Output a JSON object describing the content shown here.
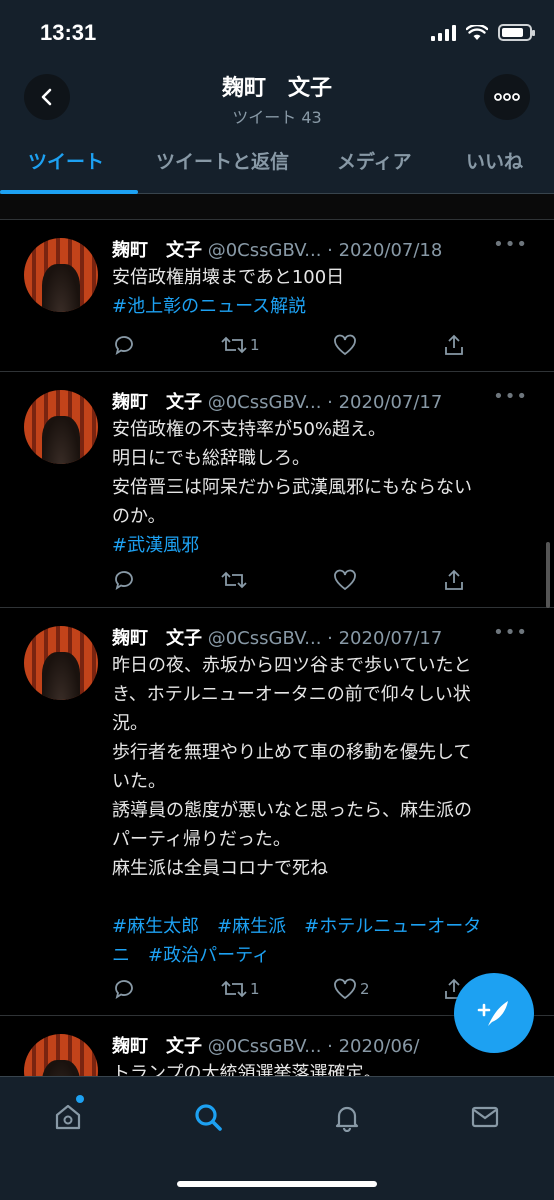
{
  "status_bar": {
    "time": "13:31"
  },
  "header": {
    "title": "麹町　文子",
    "subtitle": "ツイート 43"
  },
  "tabs": [
    {
      "label": "ツイート"
    },
    {
      "label": "ツイートと返信"
    },
    {
      "label": "メディア"
    },
    {
      "label": "いいね"
    }
  ],
  "tweets": [
    {
      "name": "麹町　文子",
      "handle": "@0CssGBV...",
      "sep": " · ",
      "date": "2020/07/18",
      "lines": [
        "安倍政権崩壊まであと100日"
      ],
      "hashtags": [
        "#池上彰のニュース解説"
      ],
      "retweets": "1",
      "likes": ""
    },
    {
      "name": "麹町　文子",
      "handle": "@0CssGBV...",
      "sep": " · ",
      "date": "2020/07/17",
      "lines": [
        "安倍政権の不支持率が50%超え。",
        "明日にでも総辞職しろ。",
        "安倍晋三は阿呆だから武漢風邪にもならない",
        "のか。"
      ],
      "hashtags": [
        "#武漢風邪"
      ],
      "retweets": "",
      "likes": ""
    },
    {
      "name": "麹町　文子",
      "handle": "@0CssGBV...",
      "sep": " · ",
      "date": "2020/07/17",
      "lines": [
        "昨日の夜、赤坂から四ツ谷まで歩いていたと",
        "き、ホテルニューオータニの前で仰々しい状",
        "況。",
        "歩行者を無理やり止めて車の移動を優先して",
        "いた。",
        "誘導員の態度が悪いなと思ったら、麻生派の",
        "パーティ帰りだった。",
        "麻生派は全員コロナで死ね"
      ],
      "hashtag_lines": [
        "#麻生太郎　#麻生派　#ホテルニューオータ",
        "ニ　#政治パーティ"
      ],
      "retweets": "1",
      "likes": "2"
    },
    {
      "name": "麹町　文子",
      "handle": "@0CssGBV...",
      "sep": " · ",
      "date": "2020/06/",
      "lines": [
        "トランプの大統領選挙落選確定。"
      ]
    }
  ],
  "icons": {
    "back": "chevron-left-icon",
    "more": "more-icon",
    "compose": "compose-icon",
    "home": "home-icon",
    "search": "search-icon",
    "notifications": "bell-icon",
    "messages": "mail-icon"
  },
  "colors": {
    "accent": "#1da1f2",
    "background": "#000000",
    "header": "#15202b"
  }
}
